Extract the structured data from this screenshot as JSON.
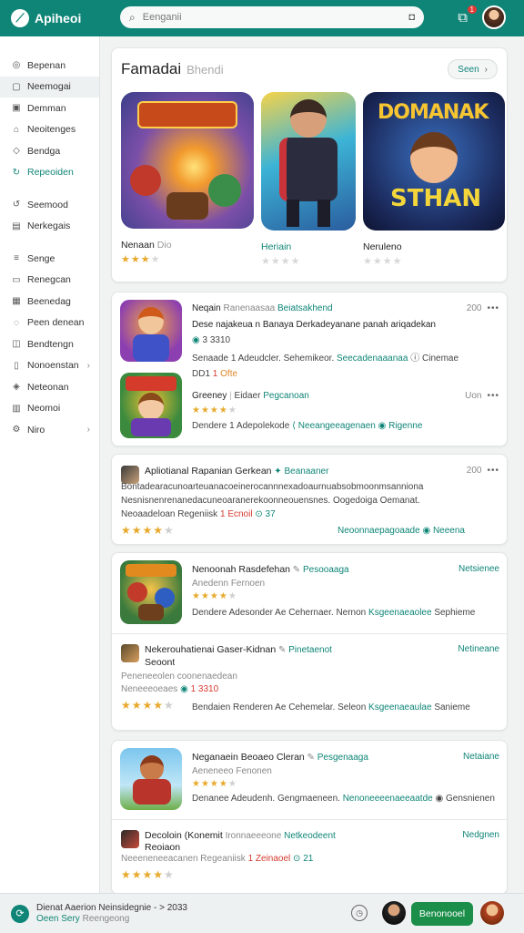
{
  "app": {
    "name": "Apiheoi",
    "logo_icon": "store-logo-icon"
  },
  "search": {
    "placeholder": "Eenganii"
  },
  "notifications": {
    "badge": "1"
  },
  "sidebar": {
    "items": [
      {
        "label": "Bepenan",
        "icon": "compass-icon"
      },
      {
        "label": "Neemogai",
        "icon": "bookmark-icon",
        "active": true
      },
      {
        "label": "Demman",
        "icon": "grid-icon"
      },
      {
        "label": "Neoitenges",
        "icon": "gift-icon"
      },
      {
        "label": "Bendga",
        "icon": "tag-icon"
      },
      {
        "label": "Repeoiden",
        "icon": "refresh-icon",
        "accent": true
      },
      {
        "label": "Seemood",
        "icon": "sync-icon"
      },
      {
        "label": "Nerkegais",
        "icon": "list-icon"
      },
      {
        "label": "Senge",
        "icon": "menu-icon"
      },
      {
        "label": "Renegcan",
        "icon": "calendar-icon"
      },
      {
        "label": "Beenedag",
        "icon": "box-icon"
      },
      {
        "label": "Peen denean",
        "icon": "chat-icon"
      },
      {
        "label": "Bendtengn",
        "icon": "bag-icon"
      },
      {
        "label": "Nonoenstan",
        "icon": "device-icon",
        "chev": "›"
      },
      {
        "label": "Neteonan",
        "icon": "document-icon"
      },
      {
        "label": "Neomoi",
        "icon": "chart-icon"
      },
      {
        "label": "Niro",
        "icon": "settings-icon",
        "chev": "›"
      }
    ]
  },
  "featured": {
    "title": "Famadai",
    "subtitle": "Bhendi",
    "see_label": "Seen",
    "items": [
      {
        "name": "Nenaan",
        "suffix": "Dio",
        "stars": 3
      },
      {
        "name": "Heriain",
        "suffix": "",
        "stars": 0
      },
      {
        "name": "Neruleno",
        "suffix": "",
        "stars": 0
      }
    ],
    "art3_text": {
      "top": "DOMANAK",
      "bottom": "STHAN"
    }
  },
  "list1": {
    "a": {
      "title": "Neqain",
      "meta": "Ranenaasaa",
      "tag": "Beiatsakhend",
      "time": "200",
      "desc": "Dese najakeua n Banaya Derkadeyanane panah ariqadekan",
      "rating_line": "3 3310",
      "footer": "Senaade 1 Adeudcler. Sehemikeor.",
      "footer_link": "Seecadenaaanaa",
      "footer_end": "Cinemae"
    },
    "b": {
      "meta": "DD1",
      "meta2": "Ofte",
      "title": "Greeney",
      "title2": "Eidaer",
      "tag": "Pegcanoan",
      "time": "Uon",
      "stars": 4,
      "footer": "Dendere 1 Adepolekode",
      "footer_link": "Neeangeeagenaen",
      "footer_end": "Rigenne"
    }
  },
  "post": {
    "title": "Apliotianal Rapanian Gerkean",
    "tag": "Beanaaner",
    "time": "200",
    "line1": "Bontadearacunoarteuanacoeinerocannnexadoaurnuabsobmoonmsanniona",
    "line2": "Nesnisnenrenanedacuneoaranerekoonneouensnes. Oogedoiga Oemanat.",
    "line3": "Neoaadeloan Regeniisk",
    "line3_red": "Ecnoil",
    "line3_count": "37",
    "stars": 4,
    "footer_link": "Neoonnaepagoaade",
    "footer_end": "Neeena"
  },
  "list2": {
    "a": {
      "title": "Nenoonah Rasdefehan",
      "tag": "Pesooaaga",
      "right": "Netsienee",
      "meta": "Anedenn Fernoen",
      "stars": 4,
      "footer": "Dendere Adesonder Ae Cehernaer. Nernon",
      "footer_link": "Ksgeenaeaolee",
      "footer_end": "Sephieme"
    },
    "b": {
      "title": "Nekerouhatienai Gaser-Kidnan",
      "title2": "Seoont",
      "tag": "Pinetaenot",
      "right": "Netineane",
      "meta1": "Peneneeolen coonenaedean",
      "meta2": "Neneeeoeaes",
      "count": "1 3310",
      "stars": 4,
      "footer": "Bendaien Renderen Ae Cehemelar. Seleon",
      "footer_link": "Ksgeenaeaulae",
      "footer_end": "Sanieme"
    }
  },
  "list3": {
    "a": {
      "title": "Neganaein Beoaeo Cleran",
      "tag": "Pesgenaaga",
      "right": "Netaiane",
      "meta": "Aeneneeo Fenonen",
      "stars": 4,
      "footer": "Denanee Adeudenh. Gengmaeneen.",
      "footer_link": "Nenoneeeenaeeaatde",
      "footer_end": "Gensnienen"
    },
    "b": {
      "title": "Decoloin (Konemit",
      "title2": "Reoiaon",
      "sub": "Ironnaeeeone",
      "tag": "Netkeodeent",
      "right": "Nedgnen",
      "meta": "Neeeneneeacanen Regeaniisk",
      "meta_red": "Zeinaoel",
      "count": "21",
      "stars": 4
    }
  },
  "footer": {
    "line1": "Dienat Aaerion Neinsidegnie - > 2033",
    "line2": "Oeen Sery",
    "line2b": "Reengeong",
    "button": "Benonooel"
  },
  "colors": {
    "brand": "#0f8577",
    "star": "#e8a92c",
    "button": "#1b8f4a",
    "accent_red": "#d63b2f"
  }
}
